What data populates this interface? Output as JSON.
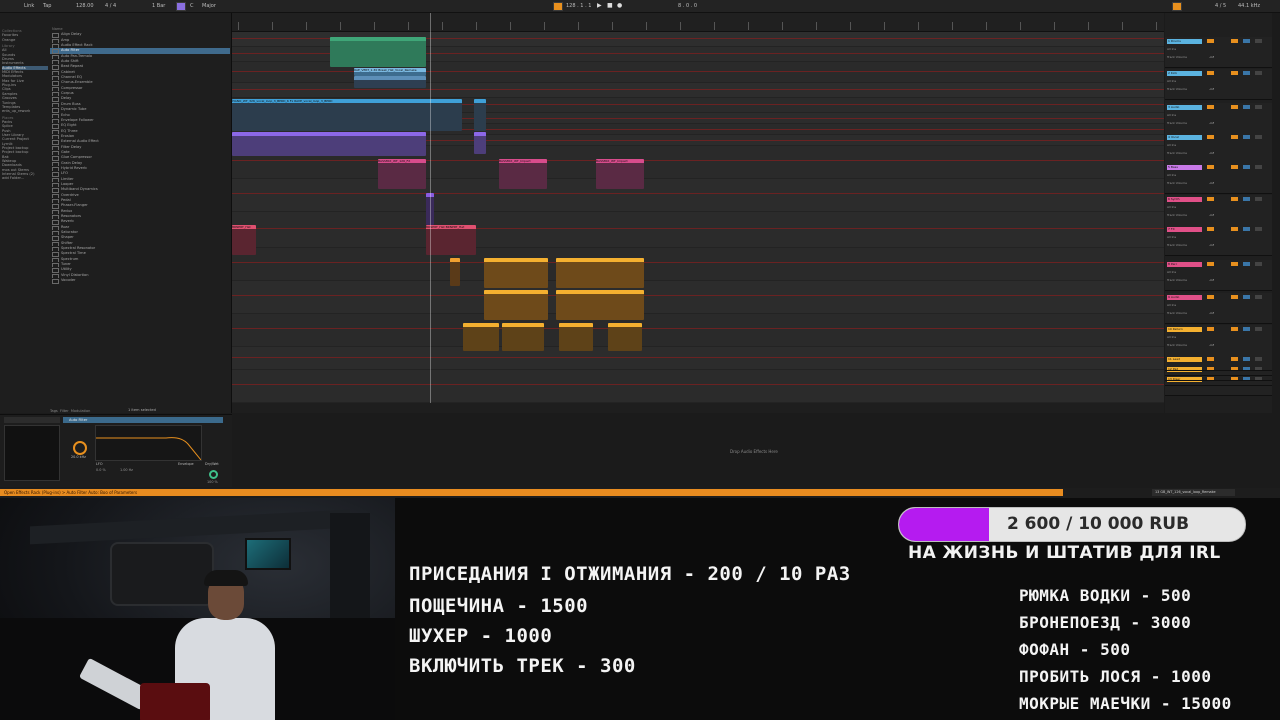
{
  "daw": {
    "topbar": {
      "link": "Link",
      "tempo_label": "Tap",
      "tempo": "128.00",
      "time_sig": "4 / 4",
      "quantize": "1 Bar",
      "key": "C",
      "scale": "Major",
      "position": "128 . 1 . 1",
      "loop_len": "8 . 0 . 0",
      "cpu": "4 / 5",
      "sample_rate": "44.1 kHz"
    },
    "browser": {
      "collections_header": "Collections",
      "collections": [
        "Favorites",
        "Orange"
      ],
      "library_header": "Library",
      "categories": [
        "All",
        "Sounds",
        "Drums",
        "Instruments",
        "Audio Effects",
        "MIDI Effects",
        "Modulators",
        "Max for Live",
        "Plug-ins",
        "Clips",
        "Samples",
        "Grooves",
        "Tunings",
        "Templates",
        "ents_up_rework"
      ],
      "places_header": "Places",
      "places": [
        "Packs",
        "Splice",
        "Push",
        "User Library",
        "Current Project",
        "Lyrnik",
        "Project backup",
        "Project backup",
        "Bak",
        "Wakeup",
        "Downloads",
        "mos out Stems",
        "Internal Stems (2)",
        "add Folder..."
      ],
      "selected_category": "Audio Effects",
      "files_header": "Name",
      "files": [
        "Align Delay",
        "Amp",
        "Audio Effect Rack",
        "Auto Filter",
        "Auto Pan-Tremolo",
        "Auto Shift",
        "Beat Repeat",
        "Cabinet",
        "Channel EQ",
        "Chorus-Ensemble",
        "Compressor",
        "Corpus",
        "Delay",
        "Drum Buss",
        "Dynamic Tube",
        "Echo",
        "Envelope Follower",
        "EQ Eight",
        "EQ Three",
        "Erosion",
        "External Audio Effect",
        "Filter Delay",
        "Gate",
        "Glue Compressor",
        "Grain Delay",
        "Hybrid Reverb",
        "LFO",
        "Limiter",
        "Looper",
        "Multiband Dynamics",
        "Overdrive",
        "Pedal",
        "Phaser-Flanger",
        "Redux",
        "Resonators",
        "Reverb",
        "Roar",
        "Saturator",
        "Shaper",
        "Shifter",
        "Spectral Resonator",
        "Spectral Time",
        "Spectrum",
        "Tuner",
        "Utility",
        "Vinyl Distortion",
        "Vocoder"
      ],
      "selected_file": "Auto Filter",
      "footer_tabs": [
        "Tags",
        "Filter",
        "Modulation"
      ],
      "footer_info": "1 item selected"
    },
    "clip_names": {
      "vocal_a": "RAE_VERT_1.30 Break_Hat_Vocal_Remake",
      "vocal_b": "PIANO_WT_326_vocal_loop_3_BPRD_6 Fx RAVE_vocal_loop_3_BPRD",
      "fx_1": "BASSMIX_WT_126_FX",
      "fx_2": "BASSMIX_WT_Impact",
      "fx_3": "BASSMIX_WT_Impact",
      "perc_1": "BRNPRT_Hat",
      "perc_2": "BRNPRT_Hat BRNPRT_Hat"
    },
    "mixer_tracks": [
      "1 Drums",
      "2 Kick",
      "3 Audio",
      "4 Vocal",
      "5 Bass",
      "6 Synth",
      "7 FX",
      "8 Perc",
      "9 Audio",
      "10 Return",
      "11 Lead",
      "12 Pad",
      "13 Riser",
      "A Reverb",
      "B Delay",
      "Master"
    ],
    "mixer_labels": {
      "ins": "All Ins",
      "channel": "All Channels",
      "monitor": "Auto",
      "output": "Master",
      "volume": "Track Volume",
      "db": "-inf"
    },
    "device": {
      "device_name": "Auto Filter",
      "freq": "20.0 kHz",
      "res": "0.0 %",
      "lfo_label": "LFO",
      "lfo_amount": "0.0 %",
      "lfo_rate": "1.00 Hz",
      "env_label": "Envelope",
      "mix_label": "Dry/Wet",
      "mix": "100 %"
    },
    "hint_text": "Drop Audio Effects Here",
    "status_text": "Open Effects Rack (Plug-ins) > Auto Filter Auto: Boo of Parameters",
    "mini_clip": "13 GB_WT_126_vocal_loop_Remake"
  },
  "overlay": {
    "donation": {
      "current": 2600,
      "goal": 10000,
      "text": "2 600 / 10 000 RUB",
      "fill_color": "#b51bf0"
    },
    "goal_label": "НА ЖИЗНЬ И ШТАТИВ ДЛЯ IRL",
    "actions_left": [
      "ПРИСЕДАНИЯ I ОТЖИМАНИЯ - 200 / 10 РАЗ",
      "ПОЩЕЧИНА - 1500",
      "ШУХЕР - 1000",
      "ВКЛЮЧИТЬ ТРЕК - 300"
    ],
    "actions_right": [
      "РЮМКА ВОДКИ - 500",
      "БРОНЕПОЕЗД - 3000",
      "ФОФАН - 500",
      "ПРОБИТЬ ЛОСЯ - 1000",
      "МОКРЫЕ МАЕЧКИ - 15000"
    ]
  }
}
